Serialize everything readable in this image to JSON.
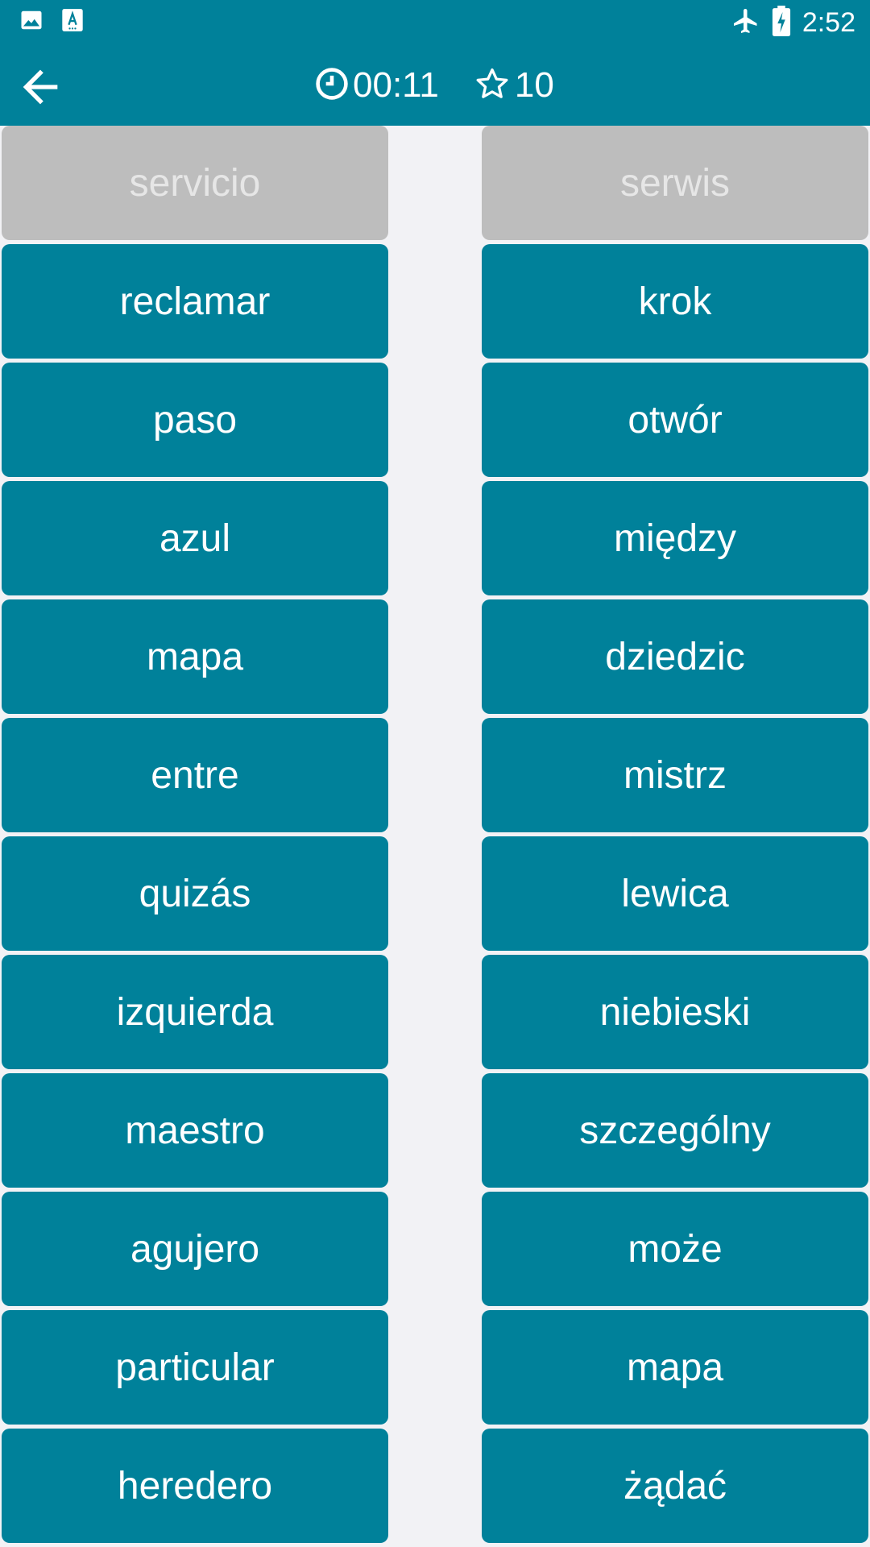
{
  "status_bar": {
    "time": "2:52",
    "icons": [
      "image-icon",
      "font-download-icon",
      "airplane-icon",
      "battery-charging-icon"
    ]
  },
  "header": {
    "timer": "00:11",
    "score": "10",
    "icons": [
      "back-arrow-icon",
      "clock-icon",
      "star-outline-icon"
    ]
  },
  "colors": {
    "primary": "#00819a",
    "matched": "#bdbdbd",
    "matched_text": "#e6e6e6",
    "background": "#f2f2f5"
  },
  "left_words": [
    {
      "text": "servicio",
      "matched": true
    },
    {
      "text": "reclamar",
      "matched": false
    },
    {
      "text": "paso",
      "matched": false
    },
    {
      "text": "azul",
      "matched": false
    },
    {
      "text": "mapa",
      "matched": false
    },
    {
      "text": "entre",
      "matched": false
    },
    {
      "text": "quizás",
      "matched": false
    },
    {
      "text": "izquierda",
      "matched": false
    },
    {
      "text": "maestro",
      "matched": false
    },
    {
      "text": "agujero",
      "matched": false
    },
    {
      "text": "particular",
      "matched": false
    },
    {
      "text": "heredero",
      "matched": false
    }
  ],
  "right_words": [
    {
      "text": "serwis",
      "matched": true
    },
    {
      "text": "krok",
      "matched": false
    },
    {
      "text": "otwór",
      "matched": false
    },
    {
      "text": "między",
      "matched": false
    },
    {
      "text": "dziedzic",
      "matched": false
    },
    {
      "text": "mistrz",
      "matched": false
    },
    {
      "text": "lewica",
      "matched": false
    },
    {
      "text": "niebieski",
      "matched": false
    },
    {
      "text": "szczególny",
      "matched": false
    },
    {
      "text": "może",
      "matched": false
    },
    {
      "text": "mapa",
      "matched": false
    },
    {
      "text": "żądać",
      "matched": false
    }
  ]
}
